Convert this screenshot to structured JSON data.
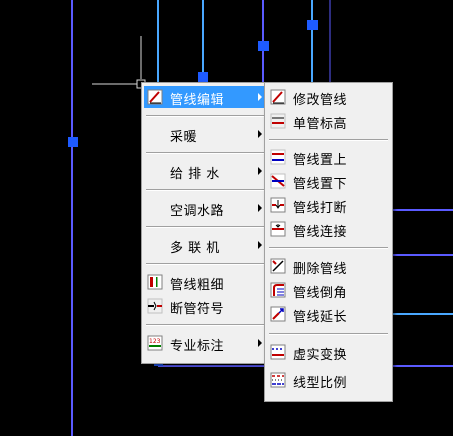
{
  "menu": {
    "items": [
      {
        "label": "管线编辑",
        "icon": "pipe-edit-icon",
        "submenu": true,
        "active": true
      },
      {
        "label": "采暖",
        "submenu": true
      },
      {
        "label": "给 排 水",
        "submenu": true
      },
      {
        "label": "空调水路",
        "submenu": true
      },
      {
        "label": "多 联 机",
        "submenu": true
      },
      {
        "label": "管线粗细",
        "icon": "pipe-width-icon",
        "submenu": false
      },
      {
        "label": "断管符号",
        "icon": "break-symbol-icon",
        "submenu": false
      },
      {
        "label": "专业标注",
        "icon": "annotation-icon",
        "submenu": true
      }
    ]
  },
  "submenu": {
    "items": [
      {
        "label": "修改管线",
        "icon": "modify-pipe-icon"
      },
      {
        "label": "单管标高",
        "icon": "pipe-elevation-icon"
      },
      {
        "label": "管线置上",
        "icon": "pipe-bring-up-icon"
      },
      {
        "label": "管线置下",
        "icon": "pipe-send-down-icon"
      },
      {
        "label": "管线打断",
        "icon": "pipe-break-icon"
      },
      {
        "label": "管线连接",
        "icon": "pipe-connect-icon"
      },
      {
        "label": "删除管线",
        "icon": "delete-pipe-icon"
      },
      {
        "label": "管线倒角",
        "icon": "pipe-fillet-icon"
      },
      {
        "label": "管线延长",
        "icon": "pipe-extend-icon"
      },
      {
        "label": "虚实变换",
        "icon": "dash-solid-toggle-icon"
      },
      {
        "label": "线型比例",
        "icon": "linetype-scale-icon"
      }
    ]
  },
  "colors": {
    "background": "#000000",
    "pipe_line": "#5a5aff",
    "pipe_line_light": "#4aa8ff",
    "grip": "#1e5bff",
    "highlight": "#3399ff",
    "menu_bg": "#f0f0f0"
  }
}
